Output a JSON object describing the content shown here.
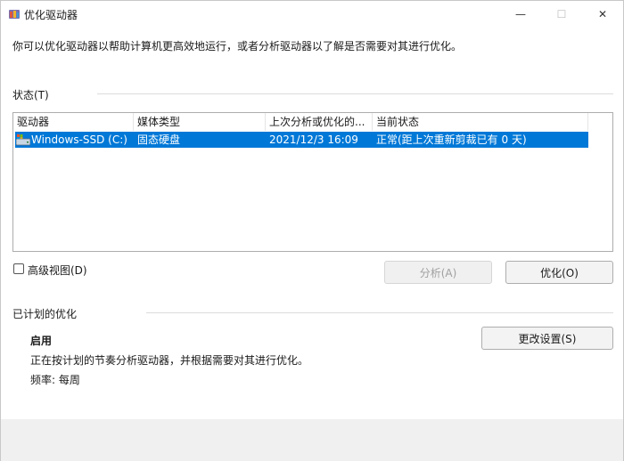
{
  "window": {
    "title": "优化驱动器",
    "controls": {
      "minimize": "—",
      "maximize": "☐",
      "close": "✕"
    }
  },
  "intro": "你可以优化驱动器以帮助计算机更高效地运行，或者分析驱动器以了解是否需要对其进行优化。",
  "status_section": {
    "label": "状态(T)",
    "columns": [
      "驱动器",
      "媒体类型",
      "上次分析或优化的...",
      "当前状态"
    ],
    "rows": [
      {
        "drive": "Windows-SSD (C:)",
        "media_type": "固态硬盘",
        "last_run": "2021/12/3 16:09",
        "current_status": "正常(距上次重新剪裁已有 0 天)",
        "selected": true
      }
    ]
  },
  "advanced_view": {
    "label": "高级视图(D)",
    "checked": false
  },
  "buttons": {
    "analyze": "分析(A)",
    "optimize": "优化(O)",
    "change_settings": "更改设置(S)"
  },
  "scheduled": {
    "label": "已计划的优化",
    "status": "启用",
    "description": "正在按计划的节奏分析驱动器，并根据需要对其进行优化。",
    "frequency": "频率: 每周"
  },
  "colors": {
    "selection": "#0078d7",
    "border": "#adadad",
    "footer": "#f0f0f0"
  }
}
